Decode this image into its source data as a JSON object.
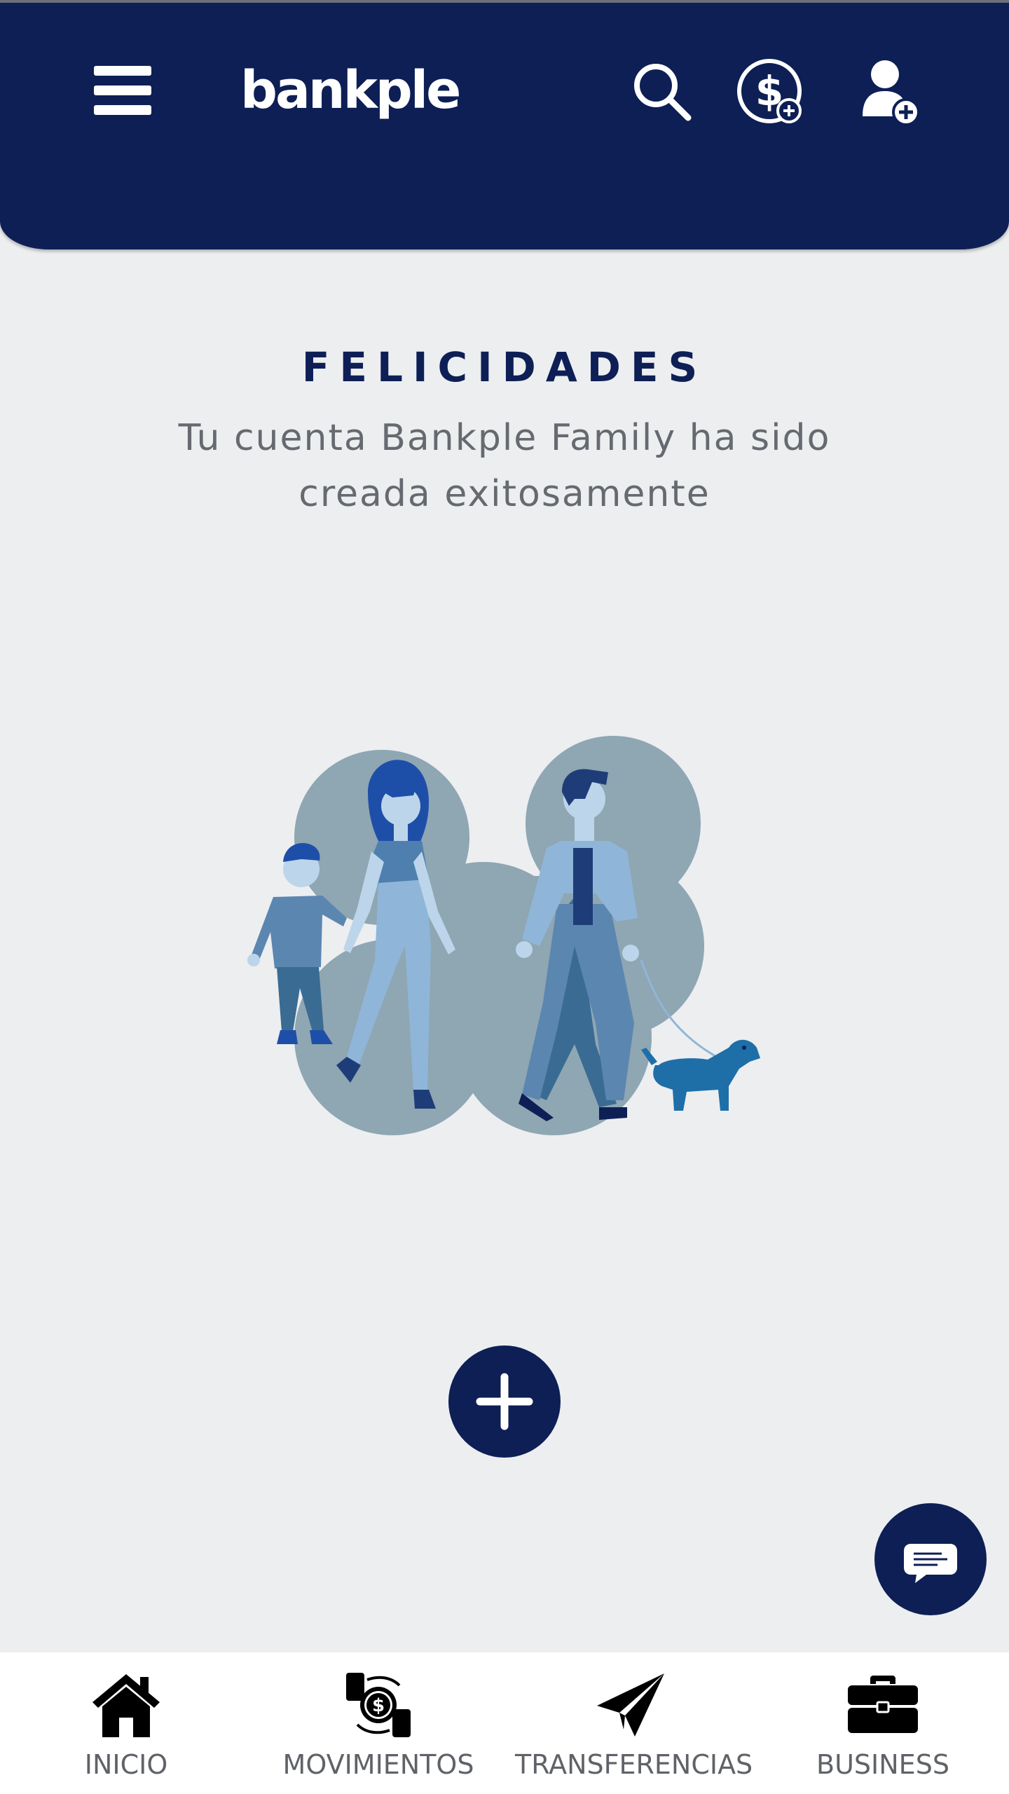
{
  "header": {
    "logo_text": "bankple"
  },
  "main": {
    "title": "FELICIDADES",
    "subtitle": "Tu cuenta Bankple Family ha sido creada exitosamente"
  },
  "icons": {
    "menu": "menu-icon",
    "search": "search-icon",
    "dollar_add": "dollar-add-icon",
    "user_add": "user-add-icon",
    "add": "plus-icon",
    "chat": "chat-icon"
  },
  "bottom_nav": {
    "items": [
      {
        "label": "INICIO",
        "icon": "home-icon"
      },
      {
        "label": "MOVIMIENTOS",
        "icon": "money-exchange-icon"
      },
      {
        "label": "TRANSFERENCIAS",
        "icon": "paper-plane-icon"
      },
      {
        "label": "BUSINESS",
        "icon": "briefcase-icon"
      }
    ]
  },
  "colors": {
    "brand_navy": "#0d1f55",
    "background": "#eceef0",
    "illustration_light": "#8fb6d8",
    "illustration_mid": "#5b86b0",
    "illustration_dark": "#1e3d78",
    "cloud": "#8fa6b3"
  }
}
